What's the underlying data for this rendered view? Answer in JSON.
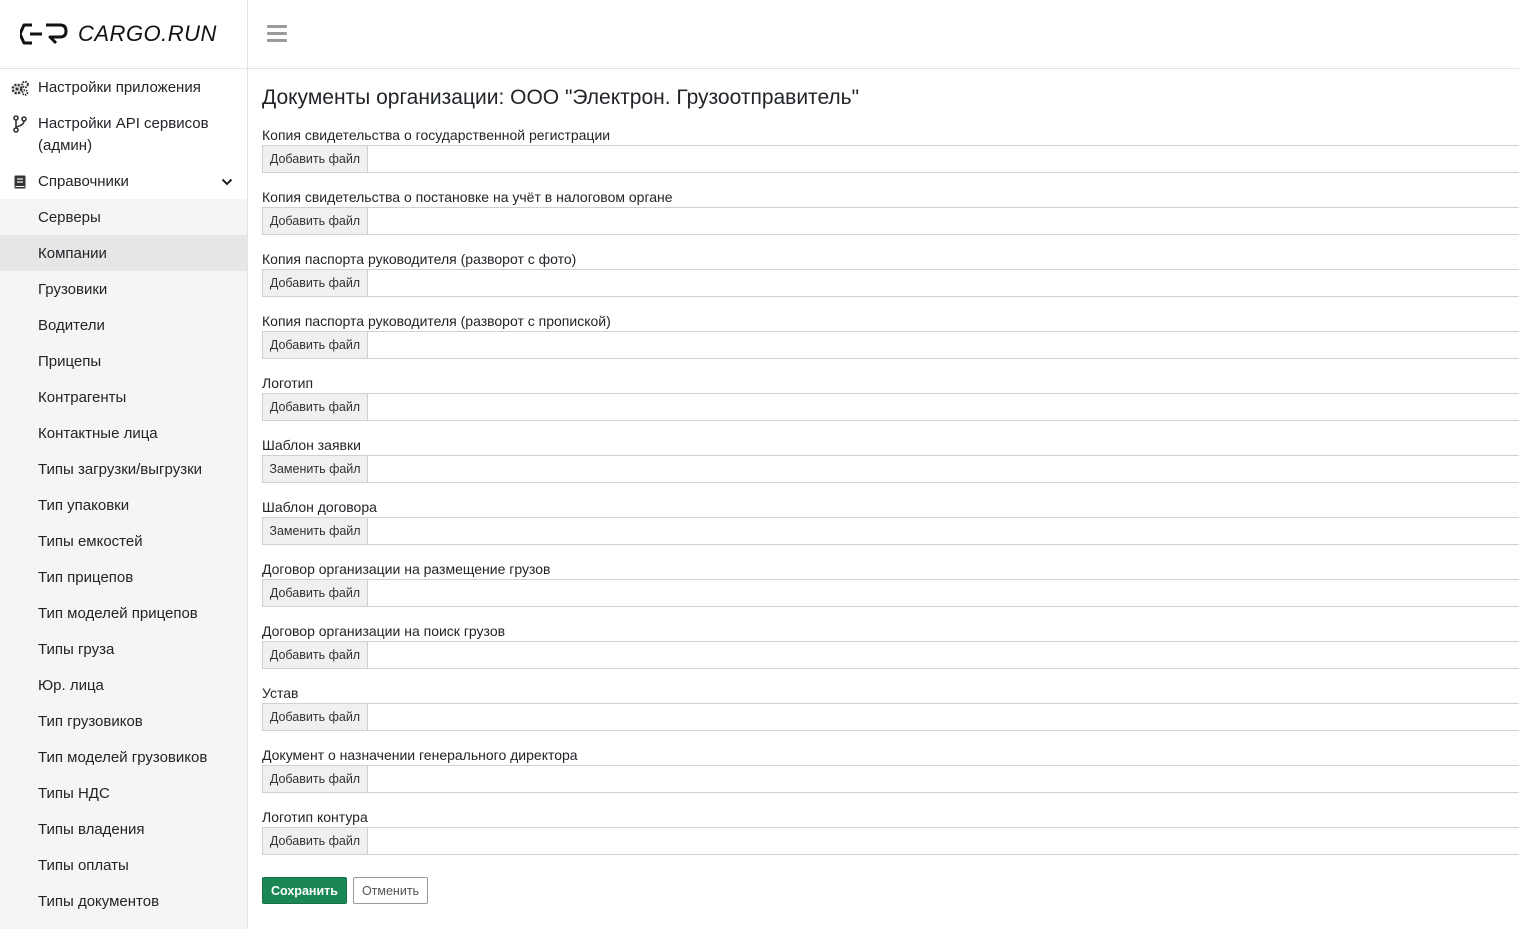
{
  "brand": {
    "name": "CARGO.RUN"
  },
  "sidebar": {
    "top_items": [
      {
        "label": "Настройки приложения",
        "icon": "gears-icon"
      },
      {
        "label": "Настройки API сервисов (админ)",
        "icon": "branch-icon"
      },
      {
        "label": "Справочники",
        "icon": "book-icon",
        "expanded": true
      }
    ],
    "sub_items": [
      {
        "label": "Серверы"
      },
      {
        "label": "Компании",
        "active": true
      },
      {
        "label": "Грузовики"
      },
      {
        "label": "Водители"
      },
      {
        "label": "Прицепы"
      },
      {
        "label": "Контрагенты"
      },
      {
        "label": "Контактные лица"
      },
      {
        "label": "Типы загрузки/выгрузки"
      },
      {
        "label": "Тип упаковки"
      },
      {
        "label": "Типы емкостей"
      },
      {
        "label": "Тип прицепов"
      },
      {
        "label": "Тип моделей прицепов"
      },
      {
        "label": "Типы груза"
      },
      {
        "label": "Юр. лица"
      },
      {
        "label": "Тип грузовиков"
      },
      {
        "label": "Тип моделей грузовиков"
      },
      {
        "label": "Типы НДС"
      },
      {
        "label": "Типы владения"
      },
      {
        "label": "Типы оплаты"
      },
      {
        "label": "Типы документов"
      }
    ]
  },
  "main": {
    "title": "Документы организации: ООО \"Электрон. Грузоотправитель\"",
    "fields": [
      {
        "label": "Копия свидетельства о государственной регистрации",
        "button": "Добавить файл"
      },
      {
        "label": "Копия свидетельства о постановке на учёт в налоговом органе",
        "button": "Добавить файл"
      },
      {
        "label": "Копия паспорта руководителя (разворот с фото)",
        "button": "Добавить файл"
      },
      {
        "label": "Копия паспорта руководителя (разворот с пропиской)",
        "button": "Добавить файл"
      },
      {
        "label": "Логотип",
        "button": "Добавить файл"
      },
      {
        "label": "Шаблон заявки",
        "button": "Заменить файл"
      },
      {
        "label": "Шаблон договора",
        "button": "Заменить файл"
      },
      {
        "label": "Договор организации на размещение грузов",
        "button": "Добавить файл"
      },
      {
        "label": "Договор организации на поиск грузов",
        "button": "Добавить файл"
      },
      {
        "label": "Устав",
        "button": "Добавить файл"
      },
      {
        "label": "Документ о назначении генерального директора",
        "button": "Добавить файл"
      },
      {
        "label": "Логотип контура",
        "button": "Добавить файл"
      }
    ],
    "save_label": "Сохранить",
    "cancel_label": "Отменить"
  },
  "colors": {
    "primary": "#1a8754",
    "active_bg": "#e6e6e6",
    "sidebar_bg": "#f5f5f5"
  }
}
